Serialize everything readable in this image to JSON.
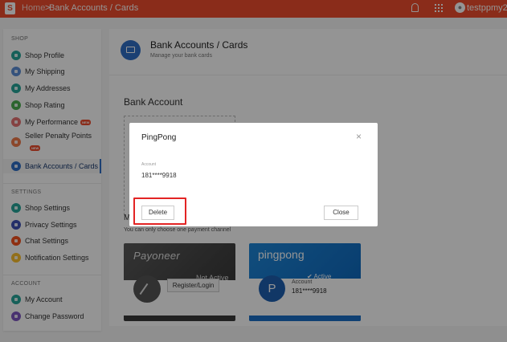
{
  "topbar": {
    "logo": "S",
    "home": "Home",
    "separator": ">",
    "current": "Bank Accounts / Cards",
    "username": "testppmy2"
  },
  "sidebar": {
    "sections": [
      {
        "head": "SHOP"
      },
      {
        "head": "SETTINGS"
      },
      {
        "head": "ACCOUNT"
      }
    ],
    "items": [
      {
        "label": "Shop Profile",
        "color": "#26a69a",
        "icon": "shop-profile-icon"
      },
      {
        "label": "My Shipping",
        "color": "#5c8dd6",
        "icon": "shipping-icon"
      },
      {
        "label": "My Addresses",
        "color": "#26a69a",
        "icon": "address-icon"
      },
      {
        "label": "Shop Rating",
        "color": "#4caf50",
        "icon": "rating-icon"
      },
      {
        "label": "My Performance",
        "color": "#e57373",
        "icon": "performance-icon",
        "badge": "NEW"
      },
      {
        "label": "Seller Penalty Points",
        "color": "#ef7b4a",
        "icon": "penalty-icon",
        "badge": "NEW"
      },
      {
        "label": "Bank Accounts / Cards",
        "color": "#2f6fc7",
        "icon": "bank-card-icon",
        "active": true
      },
      {
        "label": "Shop Settings",
        "color": "#26a69a",
        "icon": "shop-settings-icon"
      },
      {
        "label": "Privacy Settings",
        "color": "#3f51b5",
        "icon": "privacy-icon"
      },
      {
        "label": "Chat Settings",
        "color": "#f4511e",
        "icon": "chat-icon"
      },
      {
        "label": "Notification Settings",
        "color": "#fbc02d",
        "icon": "notification-icon"
      },
      {
        "label": "My Account",
        "color": "#26a69a",
        "icon": "account-icon"
      },
      {
        "label": "Change Password",
        "color": "#7e57c2",
        "icon": "password-icon"
      }
    ]
  },
  "main": {
    "title": "Bank Accounts / Cards",
    "subtitle": "Manage your bank cards",
    "bank_section": "Bank Account",
    "payment_heading_partial": "M",
    "payment_hint": "You can only choose one payment channel"
  },
  "cards": {
    "payoneer": {
      "brand": "Payoneer",
      "status": "Not Active",
      "button": "Register/Login"
    },
    "pingpong": {
      "brand": "pingpong",
      "logo": "P",
      "status": "Active",
      "account_label": "Account",
      "account_number": "181****9918"
    }
  },
  "modal": {
    "title": "PingPong",
    "close_icon": "×",
    "field_label": "Account",
    "field_value": "181****9918",
    "delete_label": "Delete",
    "close_label": "Close"
  }
}
